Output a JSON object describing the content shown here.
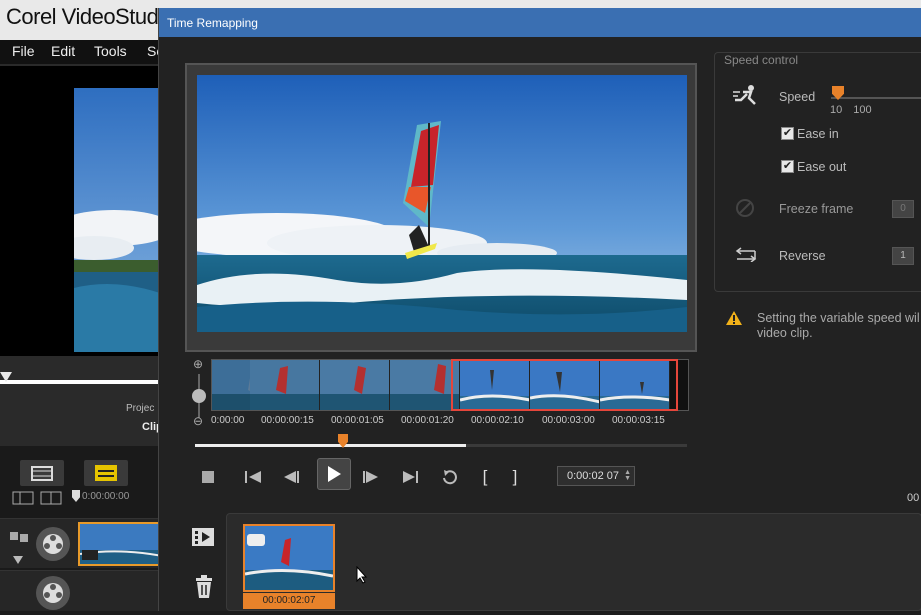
{
  "app": {
    "title": "Corel VideoStudio",
    "menu": [
      {
        "label": "File"
      },
      {
        "label": "Edit"
      },
      {
        "label": "Tools"
      },
      {
        "label": "Se"
      }
    ],
    "project_label": "Projec",
    "clip_label": "Clip",
    "timeline_time": "0:00:00:00"
  },
  "dialog": {
    "title": "Time Remapping",
    "filmstrip_ticks": [
      "0:00:00",
      "00:00:00:15",
      "00:00:01:05",
      "00:00:01:20",
      "00:00:02:10",
      "00:00:03:00",
      "00:00:03:15"
    ],
    "playback_progress": 0.55,
    "playhead_position": 0.3,
    "timecode": "0:00:02 07",
    "right_readout": "00",
    "bin_clip_time": "00:00:02:07",
    "speed_control": {
      "legend": "Speed control",
      "speed_label": "Speed",
      "speed_range": "10  100",
      "ease_in_label": "Ease in",
      "ease_in_checked": true,
      "ease_out_label": "Ease out",
      "ease_out_checked": true,
      "freeze_frame_label": "Freeze frame",
      "freeze_frame_value": "0",
      "reverse_label": "Reverse",
      "reverse_value": "1"
    },
    "warning_text": "Setting the variable speed wil video clip."
  },
  "colors": {
    "accent": "#e8822a",
    "title_bar": "#3a6fb2",
    "selection": "#e5463b"
  }
}
